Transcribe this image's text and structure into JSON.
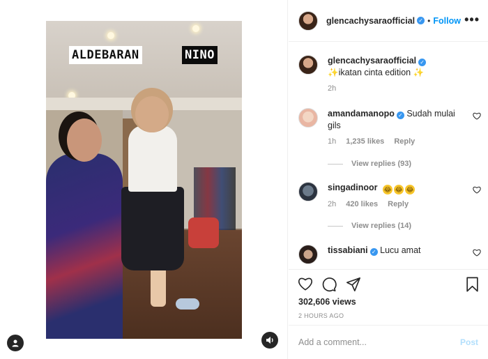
{
  "video": {
    "label_left": "ALDEBARAN",
    "label_right": "NINO"
  },
  "header": {
    "username": "glencachysaraofficial",
    "verified_mark": "✓",
    "separator": "•",
    "follow_label": "Follow",
    "more_label": "•••"
  },
  "caption": {
    "username": "glencachysaraofficial",
    "text_pre": "✨ikatan cinta edition ✨",
    "time": "2h"
  },
  "comments": [
    {
      "username": "amandamanopo",
      "verified": true,
      "text": "Sudah mulai gils",
      "time": "1h",
      "likes": "1,235 likes",
      "reply": "Reply",
      "view_replies": "View replies (93)"
    },
    {
      "username": "singadinoor",
      "verified": false,
      "emojis": [
        "😂",
        "😂",
        "😂"
      ],
      "time": "2h",
      "likes": "420 likes",
      "reply": "Reply",
      "view_replies": "View replies (14)"
    },
    {
      "username": "tissabiani",
      "verified": true,
      "text": "Lucu amat"
    }
  ],
  "stats": {
    "views": "302,606 views",
    "posted": "2 HOURS AGO"
  },
  "composer": {
    "placeholder": "Add a comment...",
    "post_label": "Post"
  },
  "colors": {
    "accent": "#0095f6",
    "verified": "#3897f0",
    "muted": "#8e8e8e"
  }
}
